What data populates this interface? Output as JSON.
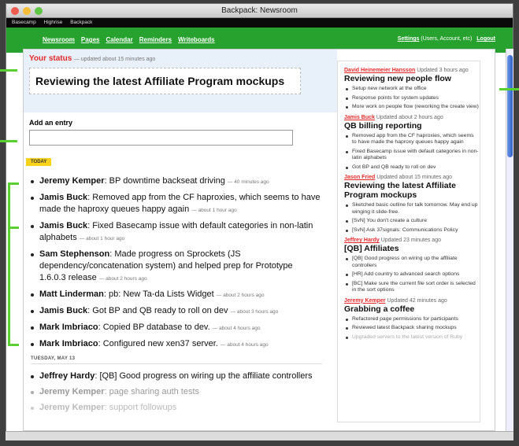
{
  "window": {
    "title": "Backpack: Newsroom"
  },
  "topbar": {
    "items": [
      "Basecamp",
      "Highrise",
      "Backpack"
    ]
  },
  "nav": {
    "links": [
      "Newsroom",
      "Pages",
      "Calendar",
      "Reminders",
      "Writeboards"
    ],
    "settings": "Settings",
    "settings_note": "(Users, Account, etc)",
    "logout": "Logout"
  },
  "status": {
    "label": "Your status",
    "updated": "— updated about 15 minutes ago",
    "text": "Reviewing the latest Affiliate Program mockups"
  },
  "add_entry": {
    "label": "Add an entry",
    "value": ""
  },
  "today": {
    "label": "TODAY",
    "entries": [
      {
        "who": "Jeremy Kemper",
        "text": ": BP downtime backseat driving",
        "time": "— 40 minutes ago"
      },
      {
        "who": "Jamis Buck",
        "text": ": Removed app from the CF haproxies, which seems to have made the haproxy queues happy again",
        "time": "— about 1 hour ago"
      },
      {
        "who": "Jamis Buck",
        "text": ": Fixed Basecamp issue with default categories in non-latin alphabets",
        "time": "— about 1 hour ago"
      },
      {
        "who": "Sam Stephenson",
        "text": ": Made progress on Sprockets (JS dependency/concatenation system) and helped prep for Prototype 1.6.0.3 release",
        "time": "— about 2 hours ago"
      },
      {
        "who": "Matt Linderman",
        "text": ": pb: New Ta-da Lists Widget",
        "time": "— about 2 hours ago"
      },
      {
        "who": "Jamis Buck",
        "text": ": Got BP and QB ready to roll on dev",
        "time": "— about 3 hours ago"
      },
      {
        "who": "Mark Imbriaco",
        "text": ": Copied BP database to dev.",
        "time": "— about 4 hours ago"
      },
      {
        "who": "Mark Imbriaco",
        "text": ": Configured new xen37 server.",
        "time": "— about 4 hours ago"
      }
    ]
  },
  "tuesday": {
    "label": "TUESDAY, MAY 13",
    "entries": [
      {
        "who": "Jeffrey Hardy",
        "text": ": [QB] Good progress on wiring up the affiliate controllers"
      },
      {
        "who": "Jeremy Kemper",
        "text": ": page sharing auth tests"
      },
      {
        "who": "Jeremy Kemper",
        "text": ": support followups"
      }
    ]
  },
  "sidebar": [
    {
      "who": "David Heinemeier Hansson",
      "updated": "Updated 3 hours ago",
      "title": "Reviewing new people flow",
      "items": [
        "Setup new network at the office",
        "Response points for system updates",
        "More work on people flow (reworking the create view)"
      ]
    },
    {
      "who": "Jamis Buck",
      "updated": "Updated about 2 hours ago",
      "title": "QB billing reporting",
      "items": [
        "Removed app from the CF haproxies, which seems to have made the haproxy queues happy again",
        "Fixed Basecamp issue with default categories in non-latin alphabets",
        "Got BP and QB ready to roll on dev"
      ]
    },
    {
      "who": "Jason Fried",
      "updated": "Updated about 15 minutes ago",
      "title": "Reviewing the latest Affiliate Program mockups",
      "items": [
        "Sketched basic outline for talk tomorrow. May end up winging it slide-free.",
        "[SvN] You don't create a culture",
        "[SvN] Ask 37signals: Communications Policy"
      ]
    },
    {
      "who": "Jeffrey Hardy",
      "updated": "Updated 23 minutes ago",
      "title": "[QB] Affiliates",
      "items": [
        "[QB] Good progress on wiring up the affiliate controllers",
        "[HR] Add country to advanced search options",
        "[BC] Make sure the current file sort order is selected in the sort options"
      ]
    },
    {
      "who": "Jeremy Kemper",
      "updated": "Updated 42 minutes ago",
      "title": "Grabbing a coffee",
      "items": [
        "Refactored page permissions for participants",
        "Reviewed latest Backpack sharing mockups",
        "Upgraded servers to the latest version of Ruby"
      ]
    }
  ],
  "colors": {
    "green": "#27a22f",
    "accent_red": "#e52a2a",
    "today_yellow": "#f8d21a",
    "highlight_green": "#58d130"
  }
}
